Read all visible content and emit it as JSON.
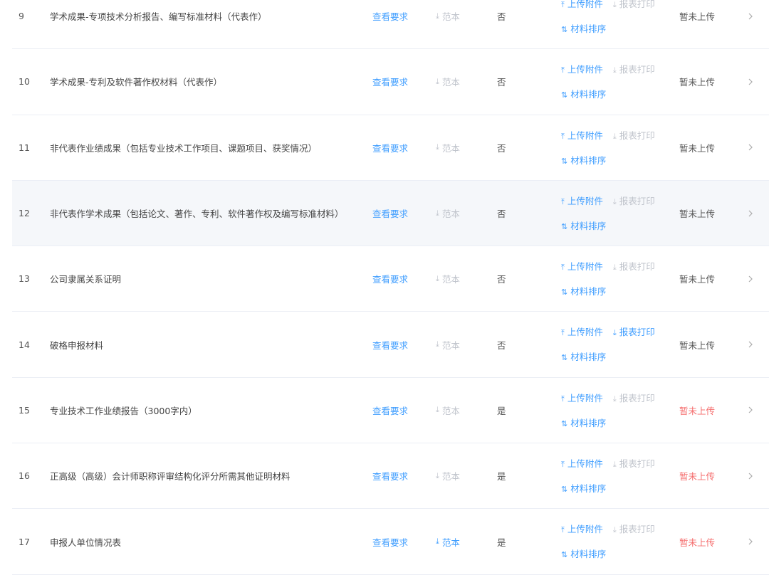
{
  "rows": [
    {
      "index": "9",
      "name": "学术成果-专项技术分析报告、编写标准材料（代表作）",
      "view_req": "查看要求",
      "sample": "范本",
      "sample_active": false,
      "required": "否",
      "upload": "上传附件",
      "print": "报表打印",
      "print_active": false,
      "sort": "材料排序",
      "status": "暂未上传",
      "status_red": false,
      "hover": false
    },
    {
      "index": "10",
      "name": "学术成果-专利及软件著作权材料（代表作）",
      "view_req": "查看要求",
      "sample": "范本",
      "sample_active": false,
      "required": "否",
      "upload": "上传附件",
      "print": "报表打印",
      "print_active": false,
      "sort": "材料排序",
      "status": "暂未上传",
      "status_red": false,
      "hover": false
    },
    {
      "index": "11",
      "name": "非代表作业绩成果（包括专业技术工作项目、课题项目、获奖情况）",
      "view_req": "查看要求",
      "sample": "范本",
      "sample_active": false,
      "required": "否",
      "upload": "上传附件",
      "print": "报表打印",
      "print_active": false,
      "sort": "材料排序",
      "status": "暂未上传",
      "status_red": false,
      "hover": false
    },
    {
      "index": "12",
      "name": "非代表作学术成果（包括论文、著作、专利、软件著作权及编写标准材料）",
      "view_req": "查看要求",
      "sample": "范本",
      "sample_active": false,
      "required": "否",
      "upload": "上传附件",
      "print": "报表打印",
      "print_active": false,
      "sort": "材料排序",
      "status": "暂未上传",
      "status_red": false,
      "hover": true
    },
    {
      "index": "13",
      "name": "公司隶属关系证明",
      "view_req": "查看要求",
      "sample": "范本",
      "sample_active": false,
      "required": "否",
      "upload": "上传附件",
      "print": "报表打印",
      "print_active": false,
      "sort": "材料排序",
      "status": "暂未上传",
      "status_red": false,
      "hover": false
    },
    {
      "index": "14",
      "name": "破格申报材料",
      "view_req": "查看要求",
      "sample": "范本",
      "sample_active": false,
      "required": "否",
      "upload": "上传附件",
      "print": "报表打印",
      "print_active": true,
      "sort": "材料排序",
      "status": "暂未上传",
      "status_red": false,
      "hover": false
    },
    {
      "index": "15",
      "name": "专业技术工作业绩报告（3000字内）",
      "view_req": "查看要求",
      "sample": "范本",
      "sample_active": false,
      "required": "是",
      "upload": "上传附件",
      "print": "报表打印",
      "print_active": false,
      "sort": "材料排序",
      "status": "暂未上传",
      "status_red": true,
      "hover": false
    },
    {
      "index": "16",
      "name": "正高级（高级）会计师职称评审结构化评分所需其他证明材料",
      "view_req": "查看要求",
      "sample": "范本",
      "sample_active": false,
      "required": "是",
      "upload": "上传附件",
      "print": "报表打印",
      "print_active": false,
      "sort": "材料排序",
      "status": "暂未上传",
      "status_red": true,
      "hover": false
    },
    {
      "index": "17",
      "name": "申报人单位情况表",
      "view_req": "查看要求",
      "sample": "范本",
      "sample_active": true,
      "required": "是",
      "upload": "上传附件",
      "print": "报表打印",
      "print_active": false,
      "sort": "材料排序",
      "status": "暂未上传",
      "status_red": true,
      "hover": false
    }
  ],
  "icons": {
    "upload": "upload-icon",
    "download": "download-icon",
    "sort": "sort-icon",
    "chevron": "chevron-right-icon"
  },
  "colors": {
    "link": "#409eff",
    "muted": "#c0c4cc",
    "danger": "#f56c6c",
    "hover_row": "#f5f7fa"
  }
}
